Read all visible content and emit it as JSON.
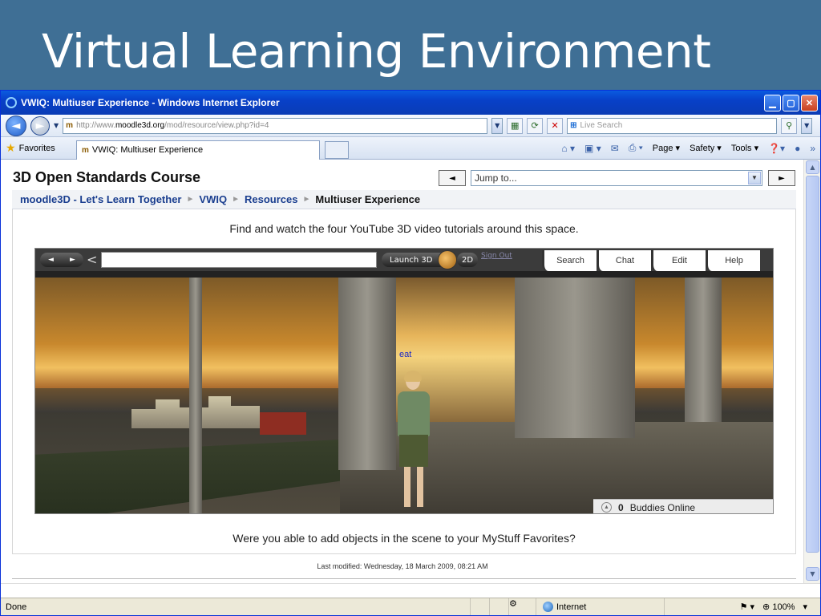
{
  "slide": {
    "title": "Virtual Learning Environment"
  },
  "window": {
    "title": "VWIQ: Multiuser Experience - Windows Internet Explorer",
    "min_glyph": "▁",
    "max_glyph": "▢",
    "close_glyph": "✕"
  },
  "address": {
    "favicon": "m",
    "url_prefix": "http://www.",
    "url_host": "moodle3d.org",
    "url_path": "/mod/resource/view.php?id=4",
    "search_placeholder": "Live Search"
  },
  "tabs": {
    "favorites_label": "Favorites",
    "active_tab": "VWIQ: Multiuser Experience",
    "commands": {
      "page": "Page",
      "safety": "Safety",
      "tools": "Tools"
    }
  },
  "page": {
    "course_title": "3D Open Standards Course",
    "jump_prev": "◄",
    "jump_next": "►",
    "jump_placeholder": "Jump to...",
    "breadcrumb": {
      "home": "moodle3D - Let's Learn Together",
      "sep": "►",
      "item1": "VWIQ",
      "item2": "Resources",
      "current": "Multiuser Experience"
    },
    "instruction_top": "Find and watch the four YouTube 3D video tutorials around this space.",
    "instruction_bottom": "Were you able to add objects in the scene to your MyStuff Favorites?",
    "last_modified": "Last modified: Wednesday, 18 March 2009, 08:21 AM"
  },
  "vw": {
    "nav_back": "◄",
    "nav_fwd": "►",
    "launch_3d": "Launch 3D",
    "btn_2d": "2D",
    "sign_out": "Sign Out",
    "tabs": {
      "search": "Search",
      "chat": "Chat",
      "edit": "Edit",
      "help": "Help"
    },
    "chat_label": "eat",
    "buddies_count": "0",
    "buddies_label": "Buddies Online"
  },
  "status": {
    "done": "Done",
    "zone": "Internet",
    "zoom": "100%"
  }
}
